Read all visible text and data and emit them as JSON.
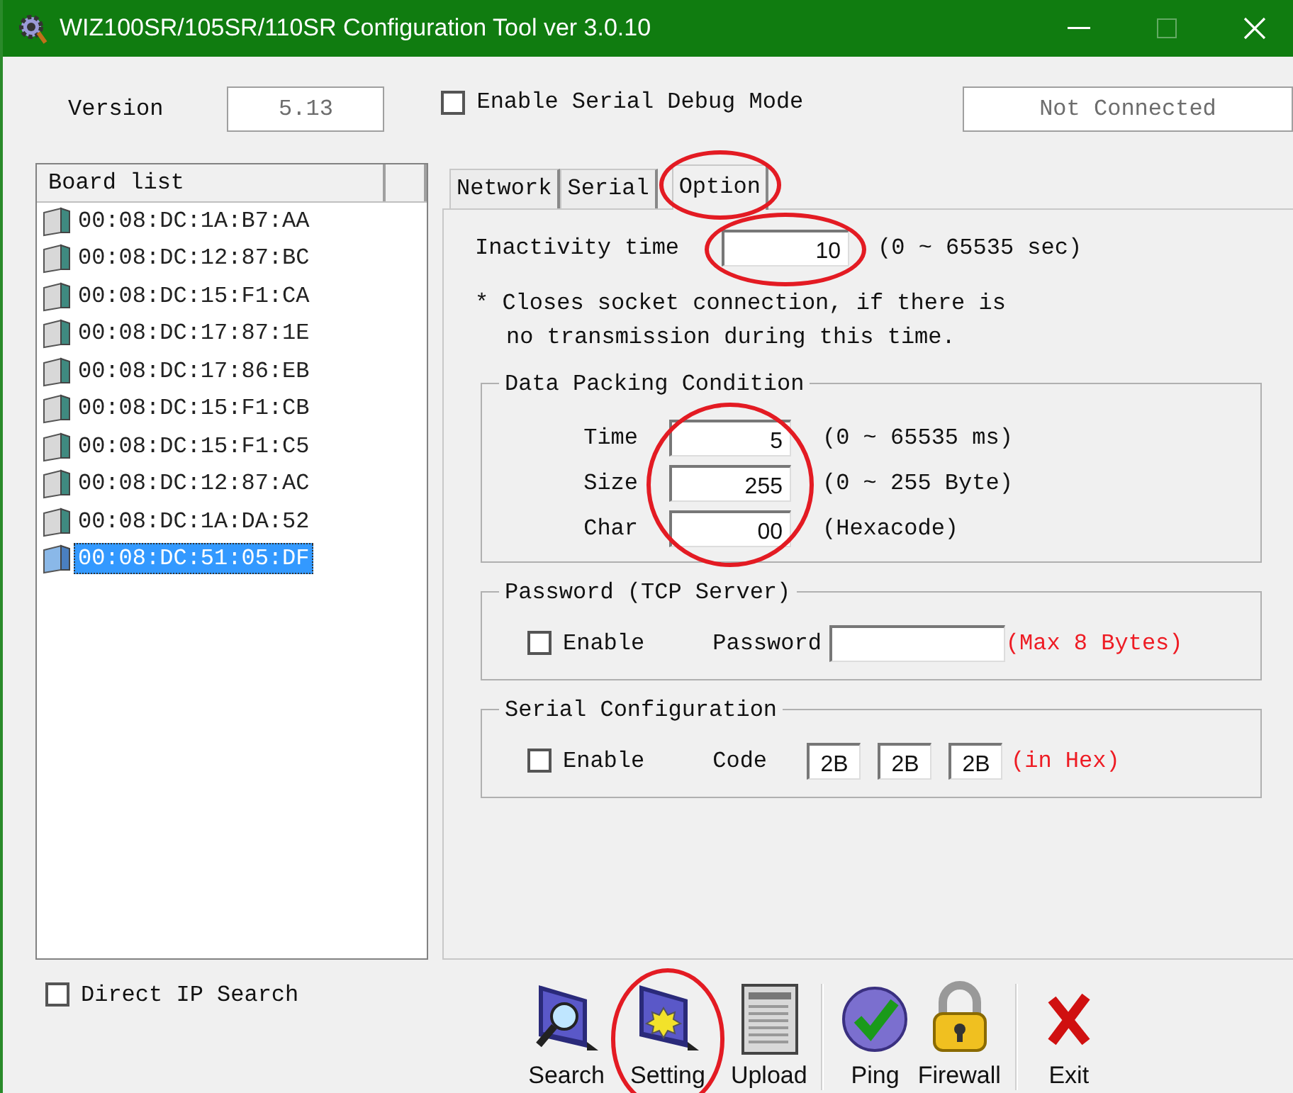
{
  "window": {
    "title": "WIZ100SR/105SR/110SR Configuration Tool ver 3.0.10",
    "maximize_disabled": true
  },
  "version": {
    "label": "Version",
    "value": "5.13"
  },
  "debug_mode": {
    "label": "Enable Serial Debug Mode",
    "checked": false
  },
  "connection_status": "Not Connected",
  "board_list": {
    "header": "Board list",
    "items": [
      {
        "mac": "00:08:DC:1A:B7:AA",
        "selected": false
      },
      {
        "mac": "00:08:DC:12:87:BC",
        "selected": false
      },
      {
        "mac": "00:08:DC:15:F1:CA",
        "selected": false
      },
      {
        "mac": "00:08:DC:17:87:1E",
        "selected": false
      },
      {
        "mac": "00:08:DC:17:86:EB",
        "selected": false
      },
      {
        "mac": "00:08:DC:15:F1:CB",
        "selected": false
      },
      {
        "mac": "00:08:DC:15:F1:C5",
        "selected": false
      },
      {
        "mac": "00:08:DC:12:87:AC",
        "selected": false
      },
      {
        "mac": "00:08:DC:1A:DA:52",
        "selected": false
      },
      {
        "mac": "00:08:DC:51:05:DF",
        "selected": true
      }
    ]
  },
  "tabs": [
    {
      "label": "Network",
      "selected": false,
      "highlighted": false
    },
    {
      "label": "Serial",
      "selected": false,
      "highlighted": false
    },
    {
      "label": "Option",
      "selected": true,
      "highlighted": true
    }
  ],
  "inactivity": {
    "label": "Inactivity time",
    "value": "10",
    "range": "(0 ~ 65535 sec)",
    "highlighted": true
  },
  "note": [
    "* Closes socket connection, if there is",
    "no transmission during this time."
  ],
  "data_packing": {
    "title": "Data Packing Condition",
    "highlighted": true,
    "fields": [
      {
        "label": "Time",
        "value": "5",
        "hint": "(0 ~ 65535 ms)"
      },
      {
        "label": "Size",
        "value": "255",
        "hint": "(0 ~ 255 Byte)"
      },
      {
        "label": "Char",
        "value": "00",
        "hint": "(Hexacode)"
      }
    ]
  },
  "password": {
    "title": "Password (TCP Server)",
    "enable": {
      "label": "Enable",
      "checked": false
    },
    "label": "Password",
    "note": "(Max 8 Bytes)"
  },
  "serial_config": {
    "title": "Serial Configuration",
    "enable": {
      "label": "Enable",
      "checked": false
    },
    "label": "Code",
    "codes": [
      "2B",
      "2B",
      "2B"
    ],
    "note": "(in Hex)"
  },
  "direct_ip_search": {
    "label": "Direct IP Search",
    "checked": false
  },
  "toolbar": [
    {
      "label": "Search",
      "kind": "search",
      "highlighted": false
    },
    {
      "label": "Setting",
      "kind": "setting",
      "highlighted": true
    },
    {
      "label": "Upload",
      "kind": "upload",
      "highlighted": false
    },
    {
      "label": "Ping",
      "kind": "ping",
      "highlighted": false
    },
    {
      "label": "Firewall",
      "kind": "firewall",
      "highlighted": false
    },
    {
      "label": "Exit",
      "kind": "exit",
      "highlighted": false
    }
  ]
}
